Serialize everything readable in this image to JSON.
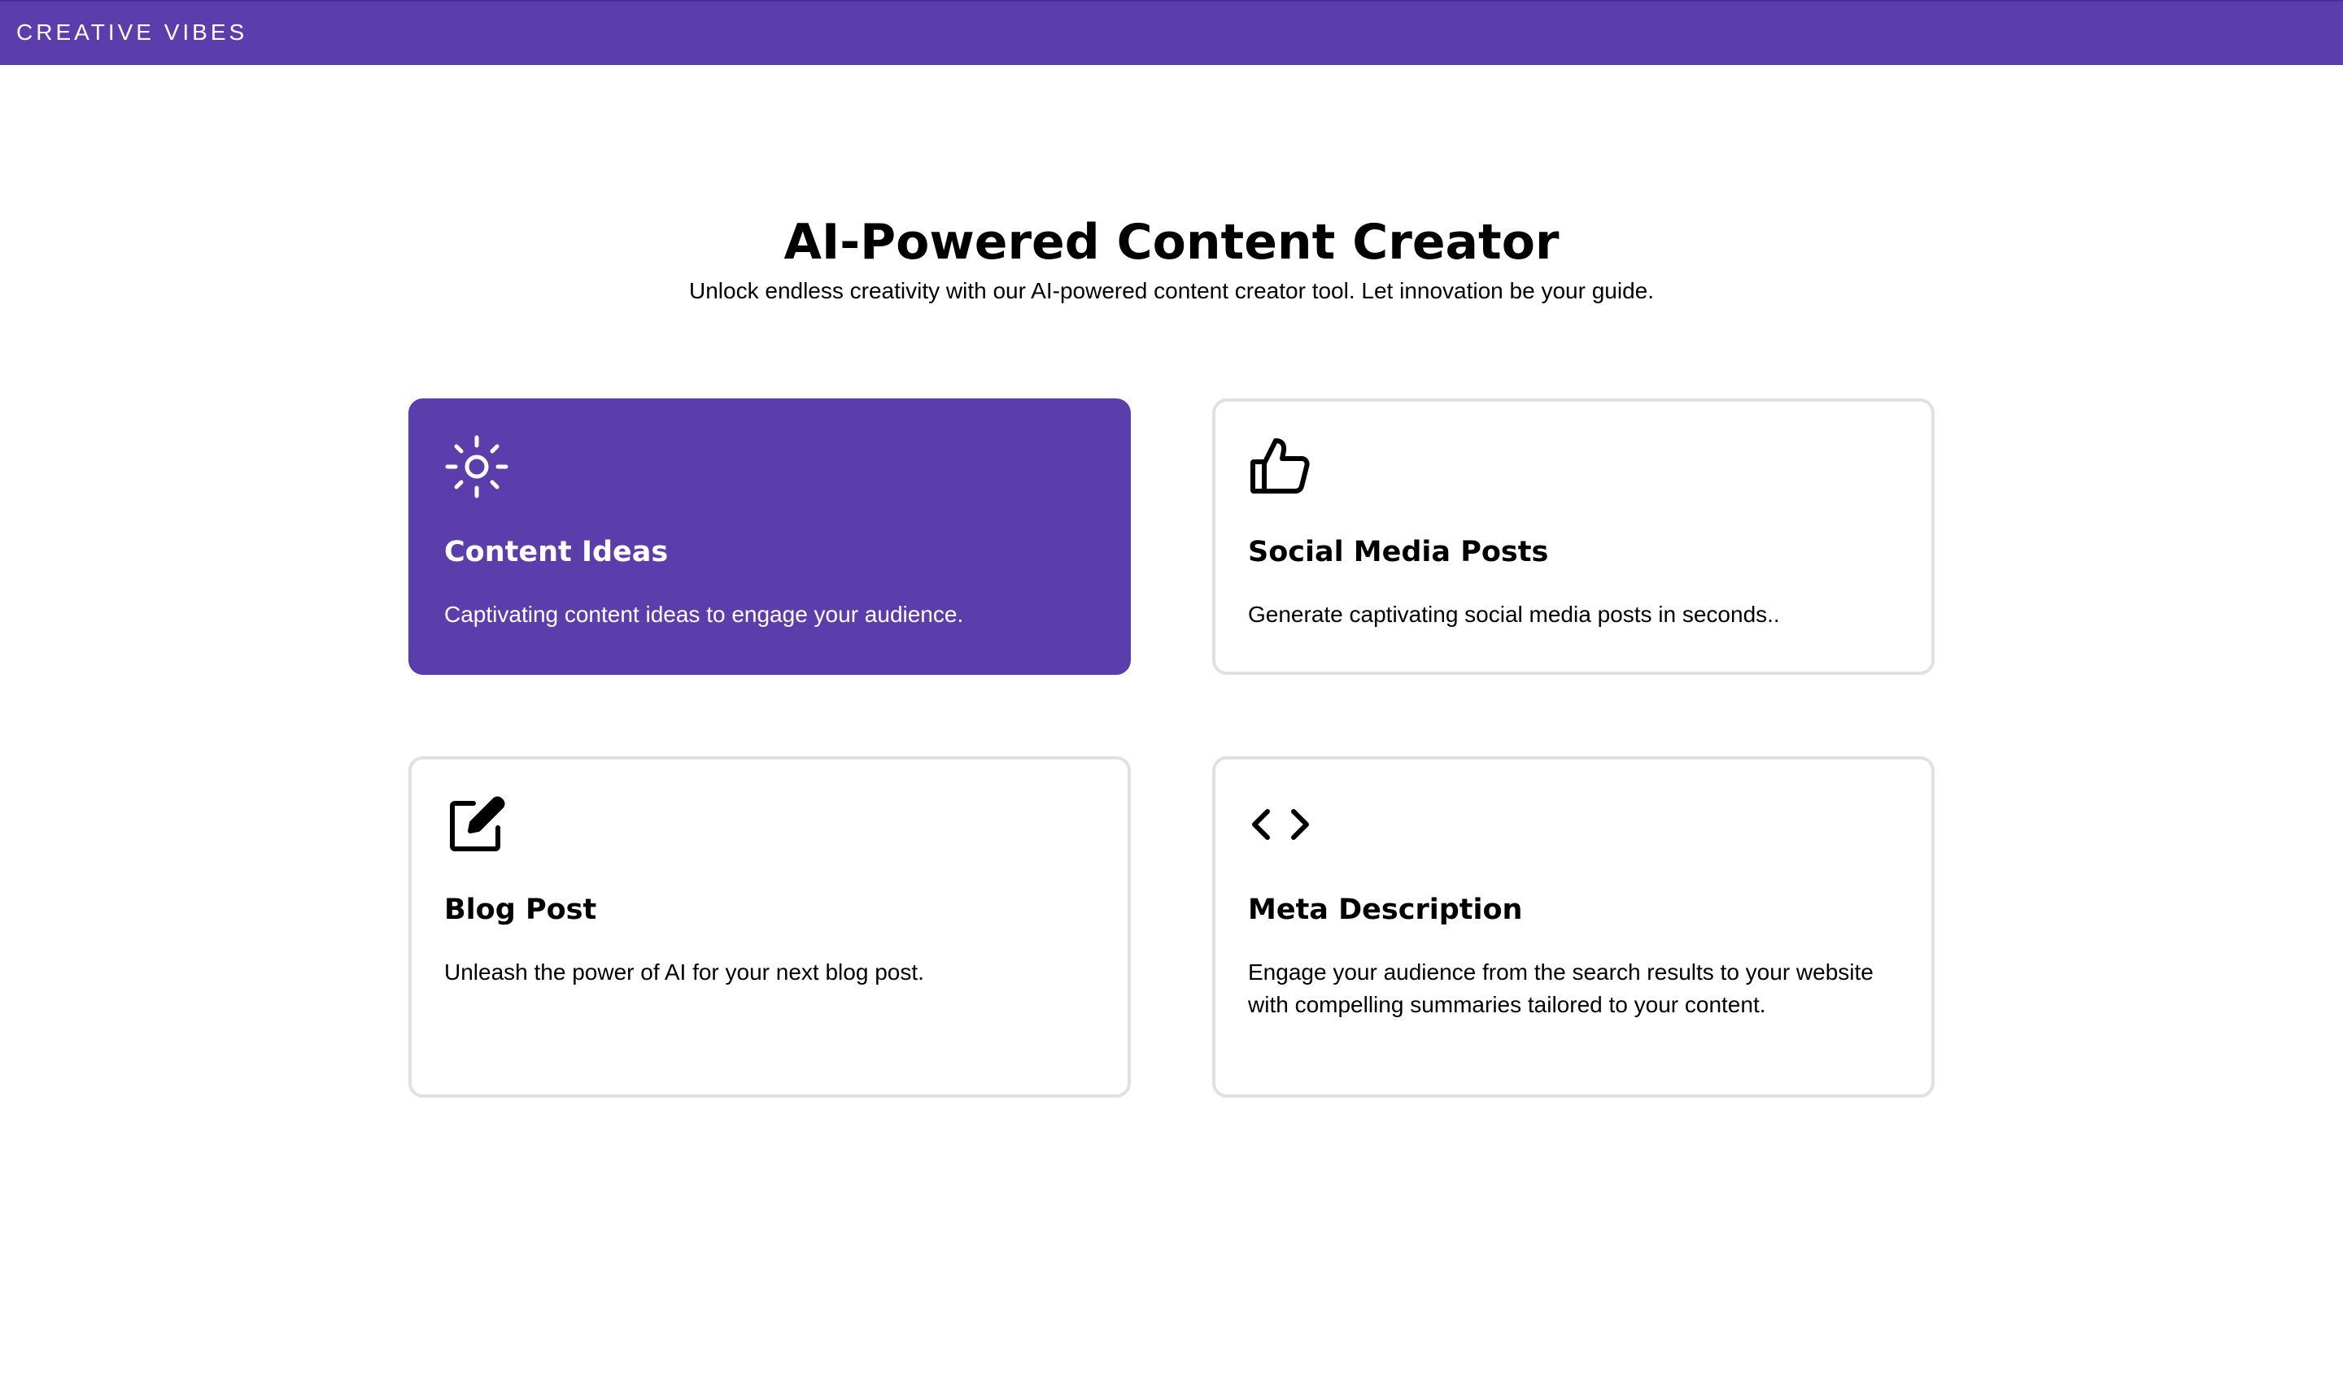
{
  "brand": "CREATIVE VIBES",
  "hero": {
    "title": "AI-Powered Content Creator",
    "subtitle": "Unlock endless creativity with our AI-powered content creator tool. Let innovation be your guide."
  },
  "colors": {
    "accent": "#5b3eac",
    "card_border": "#e1e1e1"
  },
  "cards": [
    {
      "icon": "sun-icon",
      "title": "Content Ideas",
      "description": "Captivating content ideas to engage your audience.",
      "selected": true
    },
    {
      "icon": "thumbs-up-icon",
      "title": "Social Media Posts",
      "description": "Generate captivating social media posts in seconds..",
      "selected": false
    },
    {
      "icon": "edit-icon",
      "title": "Blog Post",
      "description": "Unleash the power of AI for your next blog post.",
      "selected": false
    },
    {
      "icon": "code-icon",
      "title": "Meta Description",
      "description": "Engage your audience from the search results to your website with compelling summaries tailored to your content.",
      "selected": false
    }
  ]
}
